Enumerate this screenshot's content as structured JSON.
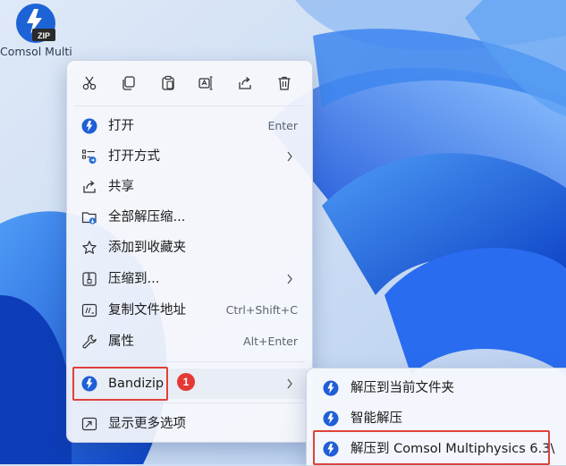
{
  "desktop": {
    "icon_name": "Comsol Multiphysi...",
    "icon_badge": "ZIP"
  },
  "toolbar": {
    "buttons": [
      "cut",
      "copy",
      "paste",
      "rename",
      "share",
      "delete"
    ]
  },
  "menu": {
    "items": [
      {
        "label": "打开",
        "shortcut": "Enter"
      },
      {
        "label": "打开方式",
        "submenu": true
      },
      {
        "label": "共享"
      },
      {
        "label": "全部解压缩..."
      },
      {
        "label": "添加到收藏夹"
      },
      {
        "label": "压缩到...",
        "submenu": true
      },
      {
        "label": "复制文件地址",
        "shortcut": "Ctrl+Shift+C"
      },
      {
        "label": "属性",
        "shortcut": "Alt+Enter"
      },
      {
        "label": "Bandizip",
        "submenu": true
      },
      {
        "label": "显示更多选项"
      }
    ]
  },
  "annotation": {
    "badge": "1"
  },
  "submenu": {
    "items": [
      {
        "label": "解压到当前文件夹"
      },
      {
        "label": "智能解压"
      },
      {
        "label": "解压到 Comsol Multiphysics 6.3\\"
      }
    ]
  },
  "colors": {
    "accent": "#1f5fd6",
    "highlight": "#e0403a",
    "wallpaper": "#1b5fe0"
  }
}
